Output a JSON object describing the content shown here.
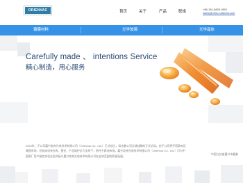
{
  "header": {
    "logo_text": "ORIENVAC",
    "nav": [
      {
        "label": "首页"
      },
      {
        "label": "关于"
      },
      {
        "label": "产品"
      },
      {
        "label": "联络"
      }
    ],
    "phone": "+86-181-6800-0501",
    "email": "sales@ofmc-material.com"
  },
  "categories": [
    {
      "label": "镀膜材料"
    },
    {
      "label": "光学玻璃"
    },
    {
      "label": "光学晶体"
    }
  ],
  "hero": {
    "title_en": "Carefully made 、 intentions Service",
    "title_cn": "精心制造，用心服务"
  },
  "intro": {
    "text": "2020年，子公司嘉兴奕肯光电技术有限公司（Orienvac Co., Ltd.）正式成立，标志着公司全球战略的正式启动。由于公司将开拓欧洲及美国市场，在欧洲设有仓库、营业、产品维护全力支持下，依托于欧洲市场，嘉兴奕肯光电技术有限公司（Orienvac Co., Ltd.）可与中国原厂用户服务实现全面对接与嘉兴奕肯光电技术有限公司在全球范围的积极拓展。"
  },
  "footnote": "中国江苏省嘉兴市嘉善",
  "colors": {
    "brand_blue": "#3592e6",
    "title_navy": "#2a4b73",
    "logo_blue": "#2f7ea6"
  }
}
